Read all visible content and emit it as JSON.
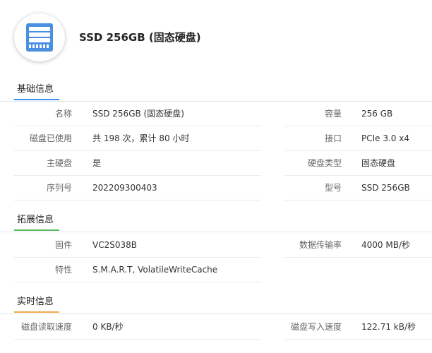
{
  "header": {
    "title": "SSD 256GB (固态硬盘)",
    "icon": "hard-disk-icon",
    "icon_color": "#4a90e2"
  },
  "sections": {
    "basic": {
      "title": "基础信息",
      "accent": "#3a8ee6",
      "left": [
        {
          "label": "名称",
          "value": "SSD 256GB (固态硬盘)"
        },
        {
          "label": "磁盘已使用",
          "value": "共 198 次，累计 80 小时"
        },
        {
          "label": "主硬盘",
          "value": "是"
        },
        {
          "label": "序列号",
          "value": "202209300403"
        }
      ],
      "right": [
        {
          "label": "容量",
          "value": "256 GB"
        },
        {
          "label": "接口",
          "value": "PCIe 3.0 x4"
        },
        {
          "label": "硬盘类型",
          "value": "固态硬盘"
        },
        {
          "label": "型号",
          "value": "SSD 256GB"
        }
      ]
    },
    "extended": {
      "title": "拓展信息",
      "accent": "#5cb85c",
      "left": [
        {
          "label": "固件",
          "value": "VC2S038B"
        },
        {
          "label": "特性",
          "value": "S.M.A.R.T, VolatileWriteCache"
        }
      ],
      "right": [
        {
          "label": "数据传输率",
          "value": "4000 MB/秒"
        }
      ]
    },
    "realtime": {
      "title": "实时信息",
      "accent": "#f0ad4e",
      "left": [
        {
          "label": "磁盘读取速度",
          "value": "0 KB/秒"
        }
      ],
      "right": [
        {
          "label": "磁盘写入速度",
          "value": "122.71 kB/秒"
        }
      ]
    }
  }
}
